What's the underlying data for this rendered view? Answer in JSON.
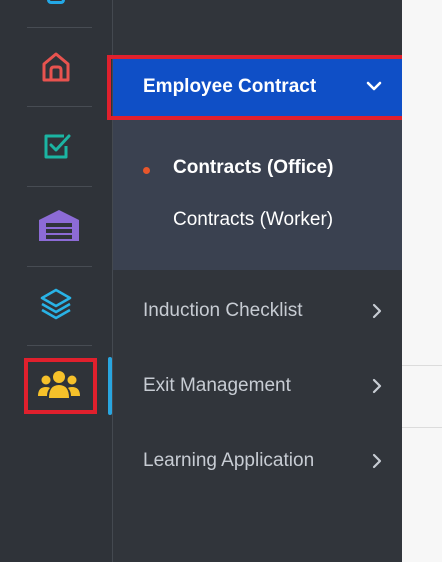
{
  "rail": {
    "icons": [
      {
        "name": "home-icon",
        "color": "#e8534f"
      },
      {
        "name": "checkbox-icon",
        "color": "#1bb5a3"
      },
      {
        "name": "warehouse-icon",
        "color": "#8c6bd6"
      },
      {
        "name": "layers-icon",
        "color": "#29b3e6"
      },
      {
        "name": "users-icon",
        "color": "#f6c12a",
        "highlighted": true
      }
    ],
    "accent_color": "#29a6e0",
    "highlight_color": "#e0202d"
  },
  "menu": {
    "header": {
      "label": "Employee Contract",
      "expanded": true,
      "color": "#0f4fc6"
    },
    "subitems": [
      {
        "label": "Contracts (Office)",
        "active": true
      },
      {
        "label": "Contracts (Worker)",
        "active": false
      }
    ],
    "items": [
      {
        "label": "Induction Checklist"
      },
      {
        "label": "Exit Management"
      },
      {
        "label": "Learning Application"
      }
    ]
  }
}
